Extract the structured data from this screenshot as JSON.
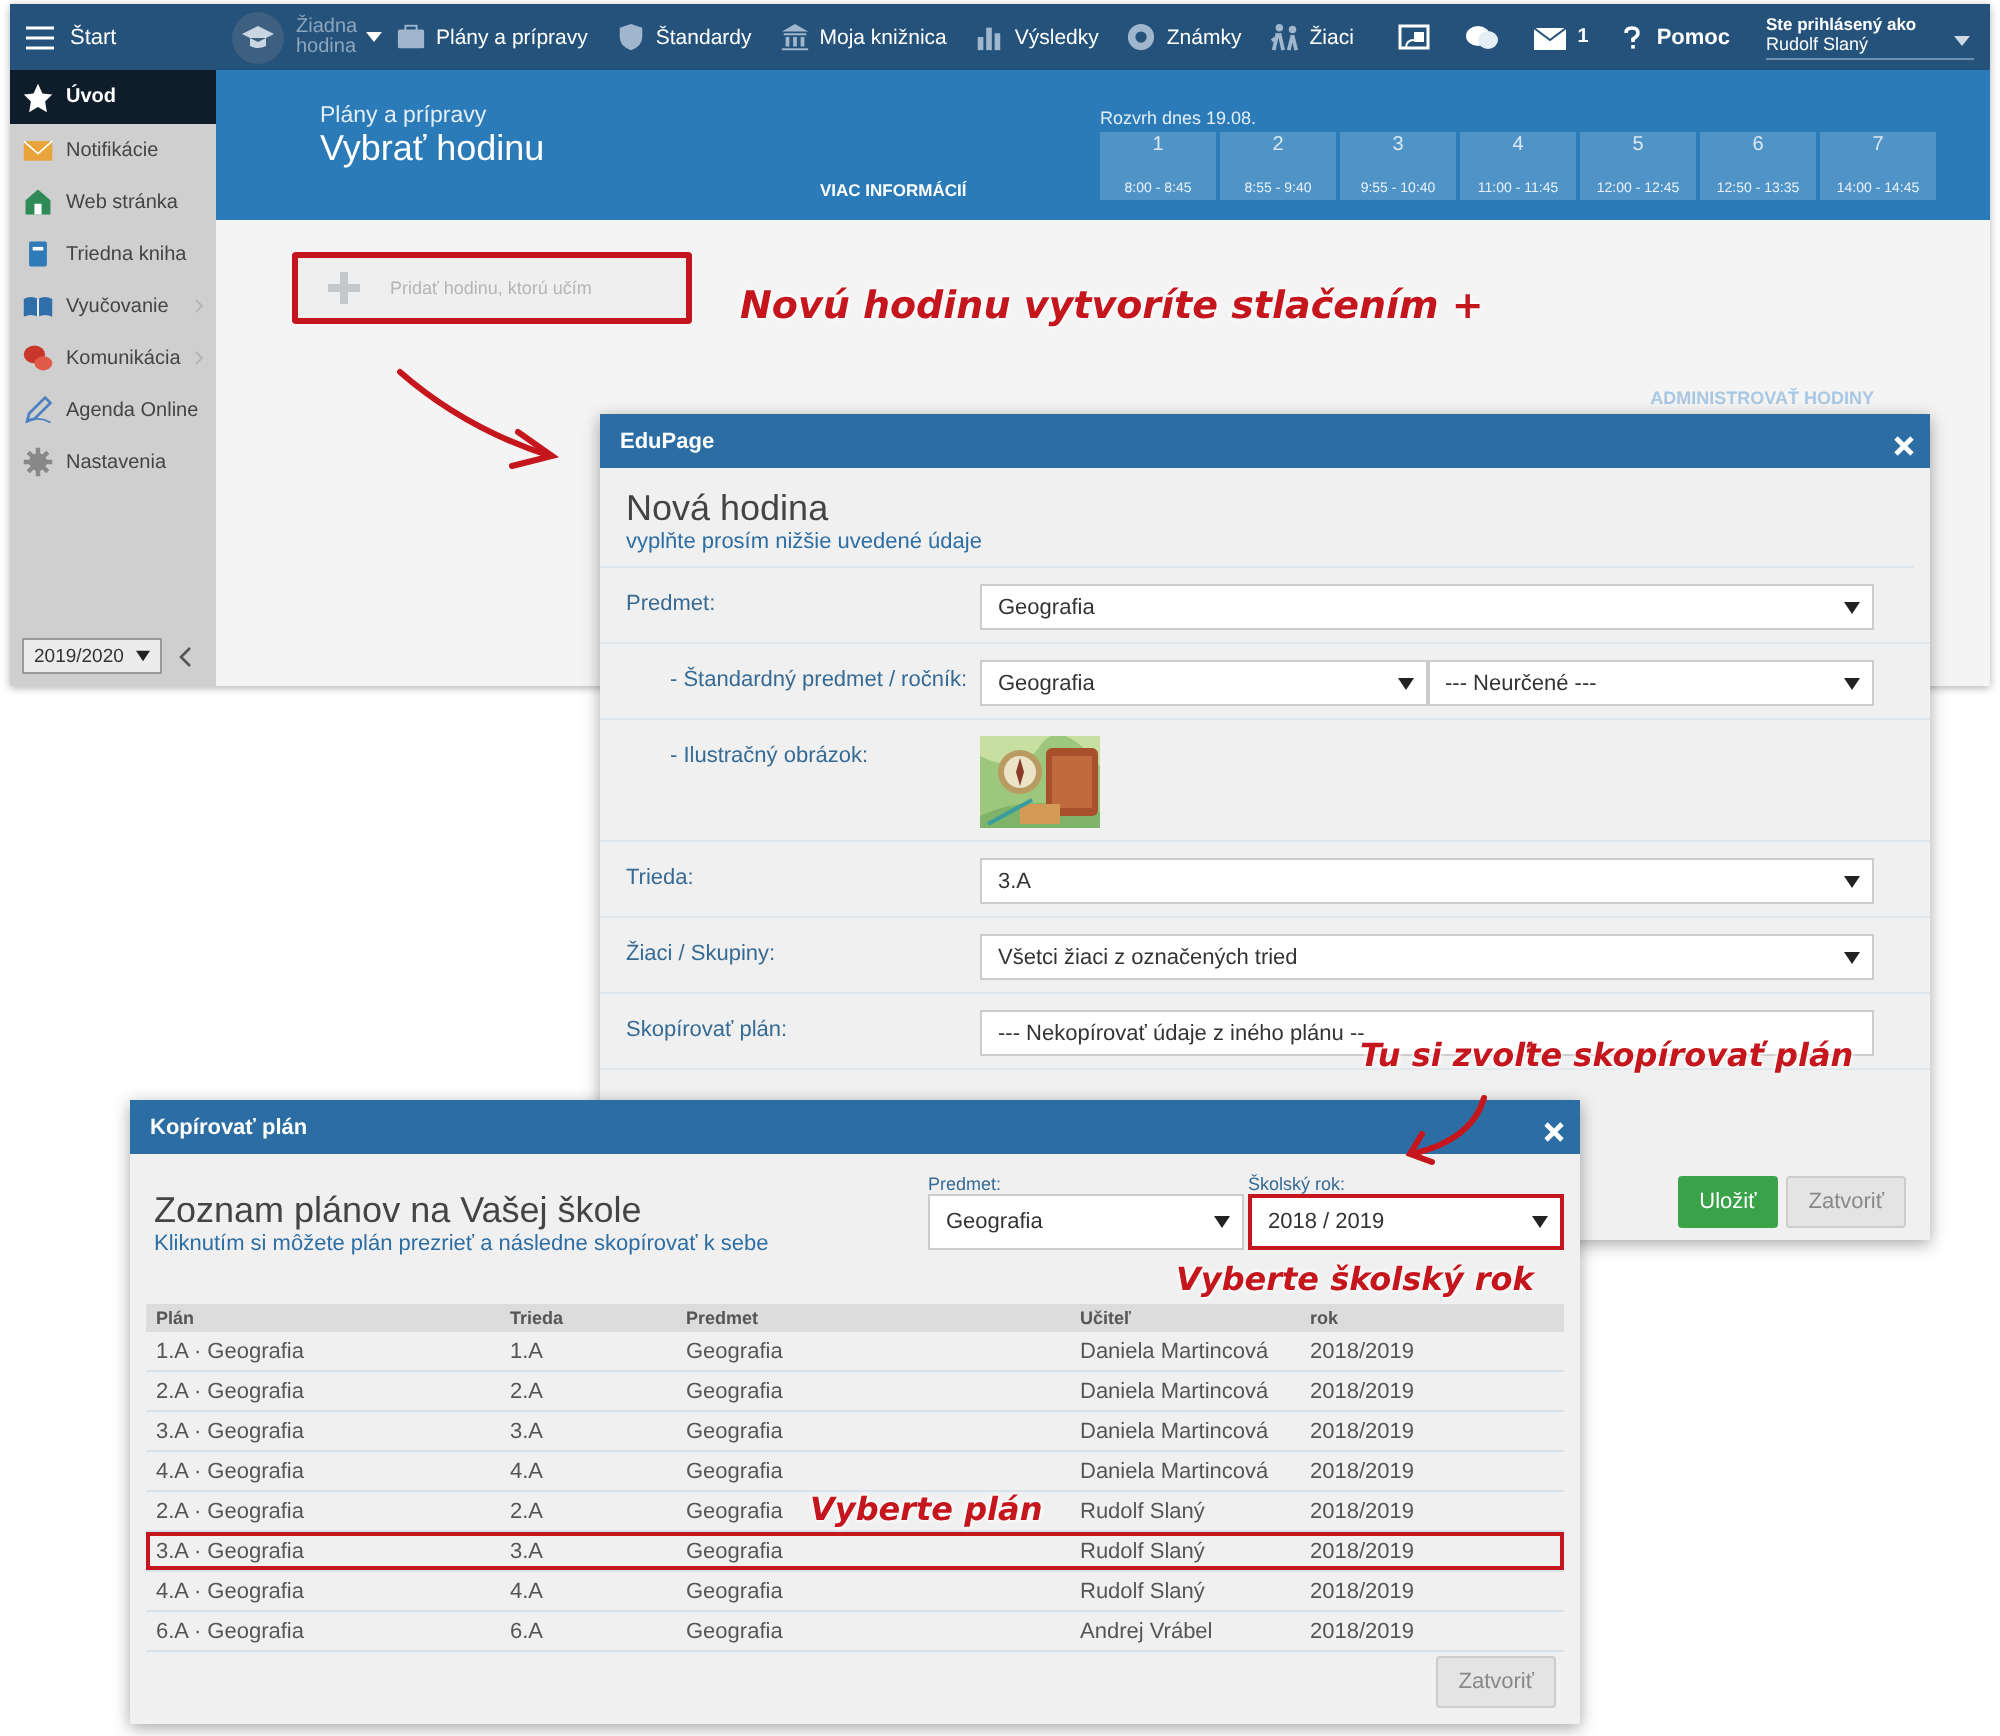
{
  "app": {
    "topbar": {
      "start": "Štart",
      "lesson": "Žiadna hodina",
      "nav": [
        "Plány a prípravy",
        "Štandardy",
        "Moja knižnica",
        "Výsledky",
        "Známky",
        "Žiaci"
      ],
      "mail_count": "1",
      "help": "Pomoc",
      "login_label": "Ste prihlásený ako",
      "user": "Rudolf Slaný"
    },
    "sidebar": {
      "items": [
        {
          "label": "Úvod",
          "selected": true,
          "expandable": false
        },
        {
          "label": "Notifikácie",
          "selected": false,
          "expandable": false
        },
        {
          "label": "Web stránka",
          "selected": false,
          "expandable": false
        },
        {
          "label": "Triedna kniha",
          "selected": false,
          "expandable": false
        },
        {
          "label": "Vyučovanie",
          "selected": false,
          "expandable": true
        },
        {
          "label": "Komunikácia",
          "selected": false,
          "expandable": true
        },
        {
          "label": "Agenda Online",
          "selected": false,
          "expandable": false
        },
        {
          "label": "Nastavenia",
          "selected": false,
          "expandable": false
        }
      ],
      "year": "2019/2020"
    },
    "header": {
      "subtitle": "Plány a prípravy",
      "title": "Vybrať hodinu",
      "more": "VIAC INFORMÁCIÍ",
      "schedule_title": "Rozvrh dnes 19.08.",
      "periods": [
        {
          "number": "1",
          "time": "8:00 - 8:45"
        },
        {
          "number": "2",
          "time": "8:55 - 9:40"
        },
        {
          "number": "3",
          "time": "9:55 - 10:40"
        },
        {
          "number": "4",
          "time": "11:00 - 11:45"
        },
        {
          "number": "5",
          "time": "12:00 - 12:45"
        },
        {
          "number": "6",
          "time": "12:50 - 13:35"
        },
        {
          "number": "7",
          "time": "14:00 - 14:45"
        }
      ]
    },
    "add_lesson": {
      "placeholder": "Pridať hodinu, ktorú učím",
      "highlighted": true
    },
    "admin_link": "ADMINISTROVAŤ HODINY"
  },
  "new_lesson_dialog": {
    "title": "EduPage",
    "heading": "Nová hodina",
    "subheading": "vyplňte prosím nižšie uvedené údaje",
    "rows": [
      {
        "kind": "select",
        "label": "Predmet:",
        "values": [
          "Geografia"
        ],
        "indent": false,
        "caret": true
      },
      {
        "kind": "select",
        "label": "- Štandardný predmet / ročník:",
        "values": [
          "Geografia",
          "--- Neurčené ---"
        ],
        "indent": true,
        "caret": true
      },
      {
        "label": "- Ilustračný obrázok:",
        "indent": true
      },
      {
        "kind": "select",
        "label": "Trieda:",
        "values": [
          "3.A"
        ],
        "indent": false,
        "caret": true
      },
      {
        "kind": "select",
        "label": "Žiaci / Skupiny:",
        "values": [
          "Všetci žiaci z označených tried"
        ],
        "indent": false,
        "caret": true
      },
      {
        "kind": "select",
        "label": "Skopírovať plán:",
        "values": [
          "--- Nekopírovať údaje z iného plánu --"
        ],
        "indent": false,
        "caret": false
      }
    ],
    "buttons": [
      "Uložiť",
      "Zatvoriť"
    ]
  },
  "copy_plan_dialog": {
    "title": "Kopírovať plán",
    "heading": "Zoznam plánov na Vašej škole",
    "subheading": "Kliknutím si môžete plán prezrieť a následne skopírovať k sebe",
    "subject": {
      "label": "Predmet:",
      "value": "Geografia",
      "highlighted": false
    },
    "year": {
      "label": "Školský rok:",
      "value": "2018 / 2019",
      "highlighted": true
    },
    "table": {
      "columns": [
        "Plán",
        "Trieda",
        "Predmet",
        "Učiteľ",
        "rok"
      ],
      "rows": [
        {
          "cells": [
            "1.A · Geografia",
            "1.A",
            "Geografia",
            "Daniela Martincová",
            "2018/2019"
          ],
          "highlighted": false
        },
        {
          "cells": [
            "2.A · Geografia",
            "2.A",
            "Geografia",
            "Daniela Martincová",
            "2018/2019"
          ],
          "highlighted": false
        },
        {
          "cells": [
            "3.A · Geografia",
            "3.A",
            "Geografia",
            "Daniela Martincová",
            "2018/2019"
          ],
          "highlighted": false
        },
        {
          "cells": [
            "4.A · Geografia",
            "4.A",
            "Geografia",
            "Daniela Martincová",
            "2018/2019"
          ],
          "highlighted": false
        },
        {
          "cells": [
            "2.A · Geografia",
            "2.A",
            "Geografia",
            "Rudolf Slaný",
            "2018/2019"
          ],
          "highlighted": false
        },
        {
          "cells": [
            "3.A · Geografia",
            "3.A",
            "Geografia",
            "Rudolf Slaný",
            "2018/2019"
          ],
          "highlighted": true
        },
        {
          "cells": [
            "4.A · Geografia",
            "4.A",
            "Geografia",
            "Rudolf Slaný",
            "2018/2019"
          ],
          "highlighted": false
        },
        {
          "cells": [
            "6.A · Geografia",
            "6.A",
            "Geografia",
            "Andrej Vrábel",
            "2018/2019"
          ],
          "highlighted": false
        }
      ]
    },
    "button": "Zatvoriť"
  },
  "annotations": [
    "Novú hodinu vytvoríte stlačením +",
    "Tu si zvoľte skopírovať plán",
    "Vyberte školský rok",
    "Vyberte plán"
  ]
}
